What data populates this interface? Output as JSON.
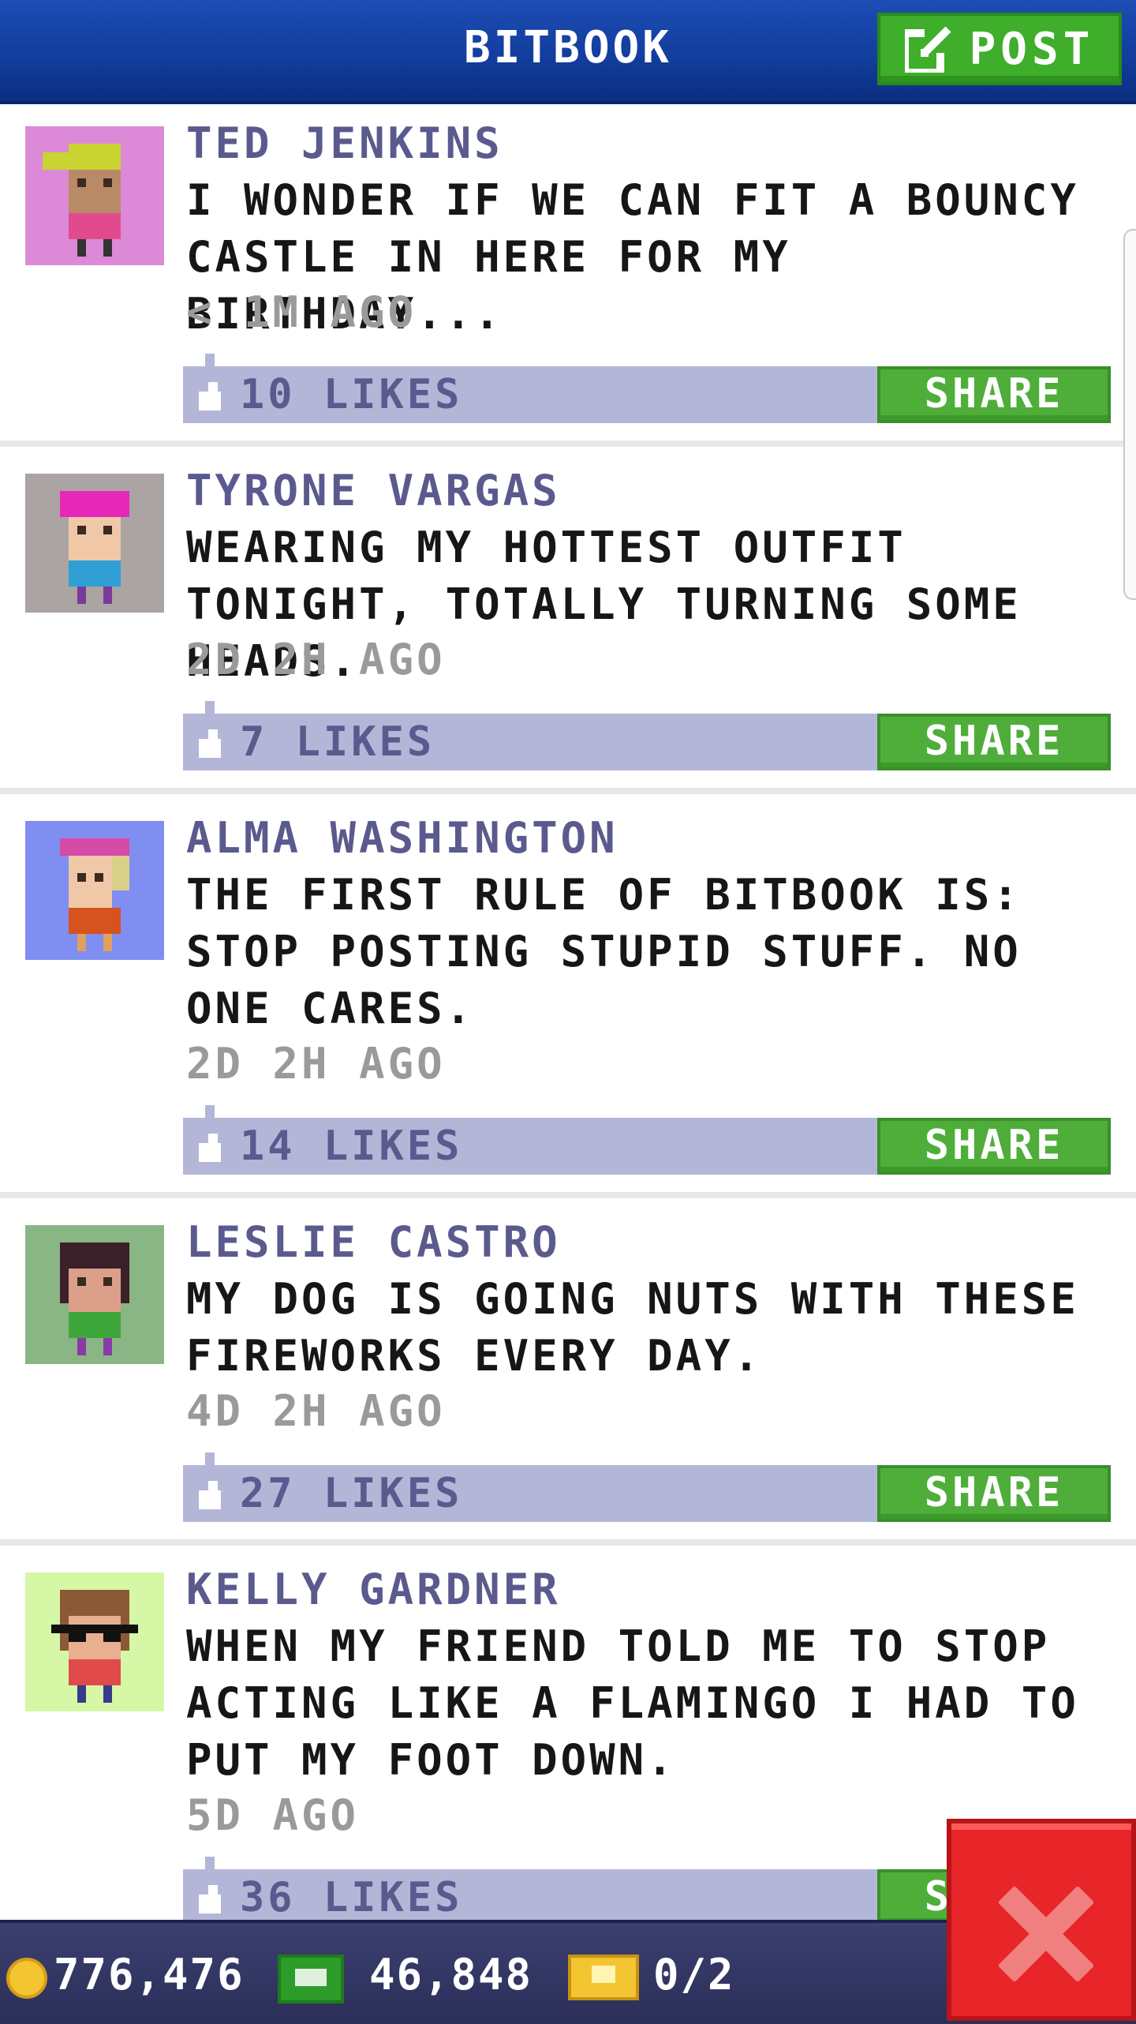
{
  "header": {
    "title": "BITBOOK",
    "post_label": "POST"
  },
  "colors": {
    "header_blue": "#123e9e",
    "action_green": "#4fae3a",
    "like_bar": "#b4b6d8",
    "name_purple": "#5a5a8e",
    "close_red": "#e8262a"
  },
  "posts": [
    {
      "name": "TED JENKINS",
      "text": "I WONDER IF WE CAN FIT A BOUNCY CASTLE IN HERE FOR MY BIRTHDAY...",
      "time": "< 1M AGO",
      "likes": "10 LIKES",
      "share": "SHARE",
      "avatar_bg": "#dc8ad8",
      "avatar_icon": "bitizen-yellow-cap-pink-shirt"
    },
    {
      "name": "TYRONE VARGAS",
      "text": "WEARING MY HOTTEST OUTFIT TONIGHT, TOTALLY TURNING SOME HEADS.",
      "time": "2D 2H AGO",
      "likes": "7 LIKES",
      "share": "SHARE",
      "avatar_bg": "#aaa4a2",
      "avatar_icon": "bitizen-pink-hair-blue-shirt"
    },
    {
      "name": "ALMA WASHINGTON",
      "text": "THE FIRST RULE OF BITBOOK IS: STOP POSTING STUPID STUFF. NO ONE CARES.",
      "time": "2D 2H AGO",
      "likes": "14 LIKES",
      "share": "SHARE",
      "avatar_bg": "#7f8ef0",
      "avatar_icon": "bitizen-blonde-orange-shirt"
    },
    {
      "name": "LESLIE CASTRO",
      "text": "MY DOG IS GOING NUTS WITH THESE FIREWORKS EVERY DAY.",
      "time": "4D 2H AGO",
      "likes": "27 LIKES",
      "share": "SHARE",
      "avatar_bg": "#8ab585",
      "avatar_icon": "bitizen-dark-hair-green-shirt"
    },
    {
      "name": "KELLY GARDNER",
      "text": "WHEN MY FRIEND TOLD ME TO STOP ACTING LIKE A FLAMINGO I HAD TO PUT MY FOOT DOWN.",
      "time": "5D AGO",
      "likes": "36 LIKES",
      "share": "SHARE",
      "avatar_bg": "#d6f7a6",
      "avatar_icon": "bitizen-glasses-red-shirt"
    }
  ],
  "status_bar": {
    "coins": "776,476",
    "bux": "46,848",
    "tickets": "0/2"
  },
  "icons": {
    "post": "compose-icon",
    "like": "thumbs-up-icon",
    "coins": "coin-icon",
    "bux": "cash-icon",
    "tickets": "ticket-icon",
    "close": "close-icon"
  }
}
